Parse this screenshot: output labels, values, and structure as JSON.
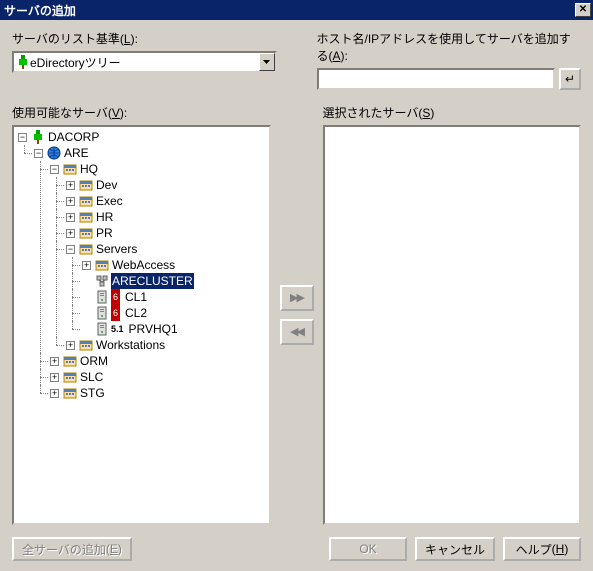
{
  "title": "サーバの追加",
  "labels": {
    "list_basis": "サーバのリスト基準",
    "list_basis_key": "L",
    "host_add": "ホスト名/IPアドレスを使用してサーバを追加する",
    "host_add_key": "A",
    "available": "使用可能なサーバ",
    "available_key": "V",
    "selected": "選択されたサーバ",
    "selected_key": "S"
  },
  "combo": {
    "value": "eDirectoryツリー"
  },
  "hostinput": {
    "value": ""
  },
  "tree": {
    "root": "DACORP",
    "n1": "ARE",
    "n2": "HQ",
    "dev": "Dev",
    "exec": "Exec",
    "hr": "HR",
    "pr": "PR",
    "servers": "Servers",
    "webaccess": "WebAccess",
    "arecluster": "ARECLUSTER",
    "cl1": "CL1",
    "cl2": "CL2",
    "prvhq1": "PRVHQ1",
    "workstations": "Workstations",
    "orm": "ORM",
    "slc": "SLC",
    "stg": "STG",
    "ver6": "6",
    "ver51": "5.1"
  },
  "buttons": {
    "add_all": "全サーバの追加",
    "add_all_key": "E",
    "ok": "OK",
    "cancel": "キャンセル",
    "help": "ヘルプ",
    "help_key": "H"
  }
}
